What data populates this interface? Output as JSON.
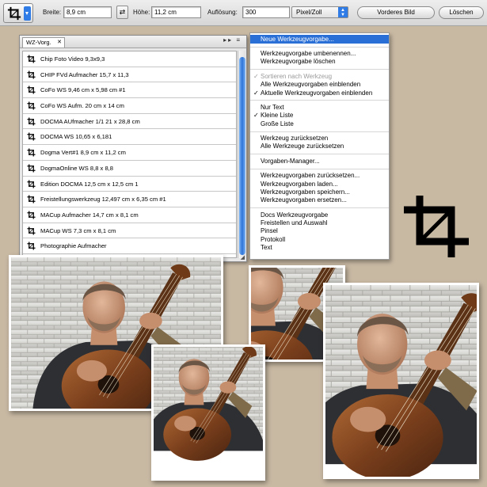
{
  "options_bar": {
    "tool_icon": "crop-tool-icon",
    "width_label": "Breite:",
    "width_value": "8,9 cm",
    "swap_icon": "swap-arrows-icon",
    "height_label": "Höhe:",
    "height_value": "11,2 cm",
    "resolution_label": "Auflösung:",
    "resolution_value": "300",
    "resolution_unit": "Pixel/Zoll",
    "front_image_button": "Vorderes Bild",
    "clear_button": "Löschen"
  },
  "presets_panel": {
    "tab_label": "WZ-Vorg.",
    "tab_close": "✕",
    "items": [
      "Chip Foto Video 9,3x9,3",
      "CHIP FVd Aufmacher 15,7 x 11,3",
      "CoFo WS 9,46 cm x 5,98 cm #1",
      "CoFo WS Aufm. 20 cm x 14 cm",
      "DOCMA AUfmacher 1/1 21 x 28,8 cm",
      "DOCMA WS 10,65 x 6,181",
      "Dogma Vert#1 8,9 cm x 11,2 cm",
      "DogmaOnline WS 8,8 x 8,8",
      "Edition DOCMA 12,5 cm x 12,5 cm 1",
      "Freistellungswerkzeug 12,497 cm x 6,35 cm #1",
      "MACup Aufmacher 14,7 cm x 8,1 cm",
      "MACup WS 7,3 cm x 8,1 cm",
      "Photographie Aufmacher"
    ]
  },
  "flyout_menu": {
    "groups": [
      [
        {
          "label": "Neue Werkzeugvorgabe...",
          "state": "highlighted"
        }
      ],
      [
        {
          "label": "Werkzeugvorgabe umbenennen...",
          "state": "normal"
        },
        {
          "label": "Werkzeugvorgabe löschen",
          "state": "normal"
        }
      ],
      [
        {
          "label": "Sortieren nach Werkzeug",
          "state": "disabled-checked"
        },
        {
          "label": "Alle Werkzeugvorgaben einblenden",
          "state": "normal"
        },
        {
          "label": "Aktuelle Werkzeugvorgaben einblenden",
          "state": "checked"
        }
      ],
      [
        {
          "label": "Nur Text",
          "state": "normal"
        },
        {
          "label": "Kleine Liste",
          "state": "checked"
        },
        {
          "label": "Große Liste",
          "state": "normal"
        }
      ],
      [
        {
          "label": "Werkzeug zurücksetzen",
          "state": "normal"
        },
        {
          "label": "Alle Werkzeuge zurücksetzen",
          "state": "normal"
        }
      ],
      [
        {
          "label": "Vorgaben-Manager...",
          "state": "normal"
        }
      ],
      [
        {
          "label": "Werkzeugvorgaben zurücksetzen...",
          "state": "normal"
        },
        {
          "label": "Werkzeugvorgaben laden...",
          "state": "normal"
        },
        {
          "label": "Werkzeugvorgaben speichern...",
          "state": "normal"
        },
        {
          "label": "Werkzeugvorgaben ersetzen...",
          "state": "normal"
        }
      ],
      [
        {
          "label": "Docs Werkzeugvorgabe",
          "state": "normal"
        },
        {
          "label": "Freistellen und Auswahl",
          "state": "normal"
        },
        {
          "label": "Pinsel",
          "state": "normal"
        },
        {
          "label": "Protokoll",
          "state": "normal"
        },
        {
          "label": "Text",
          "state": "normal"
        }
      ]
    ],
    "check_mark": "✓"
  },
  "decor": {
    "big_icon": "crop-tool-icon",
    "photos": [
      "photo-guitarist-landscape",
      "photo-guitarist-small-crop",
      "photo-guitarist-tight-square",
      "photo-guitarist-portrait"
    ]
  },
  "colors": {
    "background": "#c8b9a3",
    "accent": "#2a6fd6"
  }
}
